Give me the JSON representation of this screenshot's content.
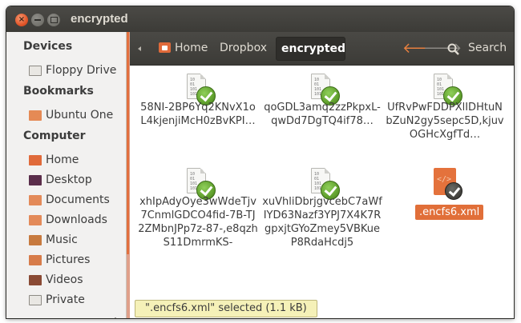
{
  "window": {
    "title": "encrypted"
  },
  "sidebar": {
    "devices_heading": "Devices",
    "bookmarks_heading": "Bookmarks",
    "computer_heading": "Computer",
    "devices": [
      {
        "label": "Floppy Drive",
        "icon": "floppy-icon"
      }
    ],
    "bookmarks": [
      {
        "label": "Ubuntu One",
        "icon": "folder-icon"
      }
    ],
    "computer": [
      {
        "label": "Home",
        "icon": "home-folder-icon"
      },
      {
        "label": "Desktop",
        "icon": "desktop-folder-icon"
      },
      {
        "label": "Documents",
        "icon": "documents-folder-icon"
      },
      {
        "label": "Downloads",
        "icon": "downloads-folder-icon"
      },
      {
        "label": "Music",
        "icon": "music-folder-icon"
      },
      {
        "label": "Pictures",
        "icon": "pictures-folder-icon"
      },
      {
        "label": "Videos",
        "icon": "videos-folder-icon"
      },
      {
        "label": "Private",
        "icon": "private-drive-icon"
      }
    ]
  },
  "toolbar": {
    "breadcrumbs": [
      "Home",
      "Dropbox",
      "encrypted"
    ],
    "search_label": "Search"
  },
  "files": [
    {
      "name": "58NI-2BP6Yq2KNvX1oL4kjenjiMcH0zBvKPI…"
    },
    {
      "name": "qoGDL3amq2zzPkpxL-qwDd7DgTQ4if78…"
    },
    {
      "name": "UfRvPwFDDPXlIDHtuNbZuN2gy5sepc5D,kjuvOGHcXgfTd…"
    },
    {
      "name": "xhIpAdyOye3wWdeTjv7CnmlGDCO4fid-7B-TJ2ZMbnJPp7z-87-,e8qzhS11DmrmKS-"
    },
    {
      "name": "xuVhliDbrjgvcebC7aWfIYD63Nazf3YPJ7X4K7RgpxjtGYoZmey5VBKueP8RdaHcdj5"
    },
    {
      "name": ".encfs6.xml"
    }
  ],
  "status": {
    "text": "\".encfs6.xml\" selected (1.1 kB)"
  },
  "colors": {
    "accent": "#e16f39",
    "check": "#5e9e2b"
  }
}
